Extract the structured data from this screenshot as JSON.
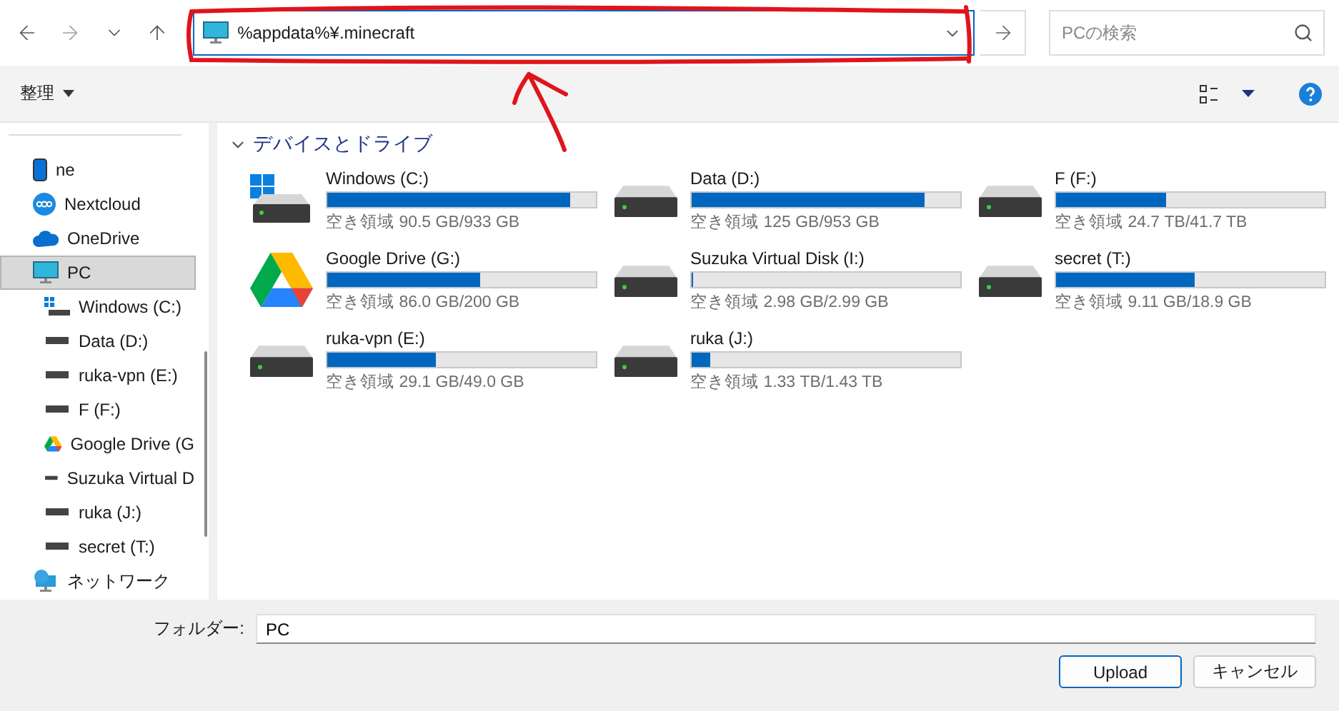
{
  "nav": {
    "address": "%appdata%¥.minecraft",
    "search_placeholder": "PCの検索"
  },
  "toolbar": {
    "organize": "整理"
  },
  "sidebar": {
    "items": [
      {
        "label": "ne",
        "kind": "phone",
        "selected": false
      },
      {
        "label": "Nextcloud",
        "kind": "nextcloud",
        "selected": false
      },
      {
        "label": "OneDrive",
        "kind": "onedrive",
        "selected": false
      },
      {
        "label": "PC",
        "kind": "pc",
        "selected": true,
        "children": [
          {
            "label": "Windows (C:)",
            "kind": "windows",
            "selected": false
          },
          {
            "label": "Data (D:)",
            "kind": "drive",
            "selected": false
          },
          {
            "label": "ruka-vpn (E:)",
            "kind": "drive",
            "selected": false
          },
          {
            "label": "F (F:)",
            "kind": "drive",
            "selected": false
          },
          {
            "label": "Google Drive (G",
            "kind": "gdrive",
            "selected": false
          },
          {
            "label": "Suzuka Virtual D",
            "kind": "drive",
            "selected": false
          },
          {
            "label": "ruka (J:)",
            "kind": "drive",
            "selected": false
          },
          {
            "label": "secret (T:)",
            "kind": "drive",
            "selected": false
          }
        ]
      },
      {
        "label": "ネットワーク",
        "kind": "network",
        "selected": false
      }
    ]
  },
  "section": {
    "title": "デバイスとドライブ",
    "expanded": true
  },
  "drives": [
    {
      "name": "Windows (C:)",
      "kind": "windows",
      "level": 0.903,
      "free": "空き領域 90.5 GB/933 GB"
    },
    {
      "name": "Data (D:)",
      "kind": "drive",
      "level": 0.869,
      "free": "空き領域 125 GB/953 GB"
    },
    {
      "name": "F (F:)",
      "kind": "drive",
      "level": 0.408,
      "free": "空き領域 24.7 TB/41.7 TB"
    },
    {
      "name": "Google Drive (G:)",
      "kind": "gdrive",
      "level": 0.57,
      "free": "空き領域 86.0 GB/200 GB"
    },
    {
      "name": "Suzuka Virtual Disk (I:)",
      "kind": "drive",
      "level": 0.004,
      "free": "空き領域 2.98 GB/2.99 GB"
    },
    {
      "name": "secret (T:)",
      "kind": "drive",
      "level": 0.518,
      "free": "空き領域 9.11 GB/18.9 GB"
    },
    {
      "name": "ruka-vpn (E:)",
      "kind": "drive",
      "level": 0.406,
      "free": "空き領域 29.1 GB/49.0 GB"
    },
    {
      "name": "ruka (J:)",
      "kind": "drive",
      "level": 0.07,
      "free": "空き領域 1.33 TB/1.43 TB"
    }
  ],
  "footer": {
    "folder_label": "フォルダー:",
    "folder_value": "PC",
    "buttons": [
      {
        "label": "Upload",
        "kind": "primary"
      },
      {
        "label": "キャンセル",
        "kind": "secondary"
      }
    ]
  }
}
